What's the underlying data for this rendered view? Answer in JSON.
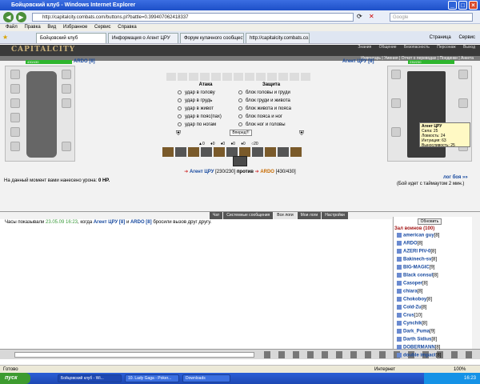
{
  "window": {
    "title": "Бойцовский клуб - Windows Internet Explorer"
  },
  "address": {
    "url": "http://capitalcity.combats.com/buttons.pl?battle=0.399407062418337",
    "search_placeholder": "Google"
  },
  "menu": [
    "Файл",
    "Правка",
    "Вид",
    "Избранное",
    "Сервис",
    "Справка"
  ],
  "tabs": [
    "Бойцовский клуб",
    "Информация о Агент ЦРУ",
    "Форум кулачного сообщест...",
    "http://capitalcity.combats.co..."
  ],
  "tab_tools": {
    "page": "Страница",
    "service": "Сервис"
  },
  "game": {
    "logo": "CAPITALCITY",
    "top_menu": [
      "Знания",
      "Общение",
      "Безопасность",
      "Персонаж",
      "Выход"
    ],
    "sub_menu": "Инвентарь | Умения | Отчет о переводах | Поединки | Анкета",
    "player_left": {
      "name": "ARDO [8]",
      "hp": "430/430"
    },
    "player_right": {
      "name": "Агент ЦРУ [8]",
      "hp": "230/230"
    },
    "attack_title": "Атака",
    "defense_title": "Защита",
    "attack_options": [
      "удар в голову",
      "удар в грудь",
      "удар в живот",
      "удар в пояс(пах)",
      "удар по ногам"
    ],
    "defense_options": [
      "блок головы и груди",
      "блок груди и живота",
      "блок живота и пояса",
      "блок пояса и ног",
      "блок ног и головы"
    ],
    "forward_button": "Вперед!!!",
    "counters": [
      "0",
      "0",
      "0",
      "0",
      "0",
      "20"
    ],
    "tooltip": [
      "Агент ЦРУ",
      "Сила: 25",
      "Ловкость: 24",
      "Интуиция: 63",
      "Выносливость: 25"
    ],
    "vs": {
      "left": "Агент ЦРУ",
      "left_hp": "[230/230]",
      "word": "против",
      "right": "ARDO",
      "right_hp": "[430/430]"
    },
    "damage_text": "На данный момент вами нанесено урона:",
    "damage_value": "0 HP.",
    "log_link": "лог боя »»",
    "timeout_text": "(Бой идет с таймаутом 2 мин.)"
  },
  "chat": {
    "tabs": [
      "Чат",
      "Системные сообщения",
      "Все логи",
      "Мои логи",
      "Настройки"
    ],
    "message": {
      "prefix": "Часы показывали",
      "time": "23.05.09 16:23",
      "mid": ", когда",
      "a": "Агент ЦРУ [8]",
      "and": "и",
      "b": "ARDO [8]",
      "suffix": "бросили вызов друг другу."
    }
  },
  "users": {
    "refresh": "Обновить",
    "title": "Зал воинов (100)",
    "list": [
      {
        "name": "american guy",
        "lvl": "[8]"
      },
      {
        "name": "ARDO",
        "lvl": "[8]"
      },
      {
        "name": "AZERI PIV-0",
        "lvl": "[8]"
      },
      {
        "name": "Bakinech-sv",
        "lvl": "[8]"
      },
      {
        "name": "BIG-MAGIC",
        "lvl": "[9]"
      },
      {
        "name": "Black consul",
        "lvl": "[8]"
      },
      {
        "name": "Casoper",
        "lvl": "[8]"
      },
      {
        "name": "chiara",
        "lvl": "[8]"
      },
      {
        "name": "Chokoboy",
        "lvl": "[8]"
      },
      {
        "name": "Cold-Zu",
        "lvl": "[8]"
      },
      {
        "name": "Crus",
        "lvl": "[10]"
      },
      {
        "name": "Cynchik",
        "lvl": "[8]"
      },
      {
        "name": "Dark_Puma",
        "lvl": "[9]"
      },
      {
        "name": "Darth Sidius",
        "lvl": "[8]"
      },
      {
        "name": "DOBERMANN",
        "lvl": "[8]"
      },
      {
        "name": "double impact",
        "lvl": "[8]"
      }
    ]
  },
  "status": {
    "left": "Готово",
    "zone": "Интернет",
    "zoom": "100%"
  },
  "taskbar": {
    "start": "пуск",
    "tasks": [
      "Бойцовский клуб - Wi...",
      "10. Lady Gaga - Poker...",
      "Downloads"
    ],
    "clock": "16:23"
  }
}
